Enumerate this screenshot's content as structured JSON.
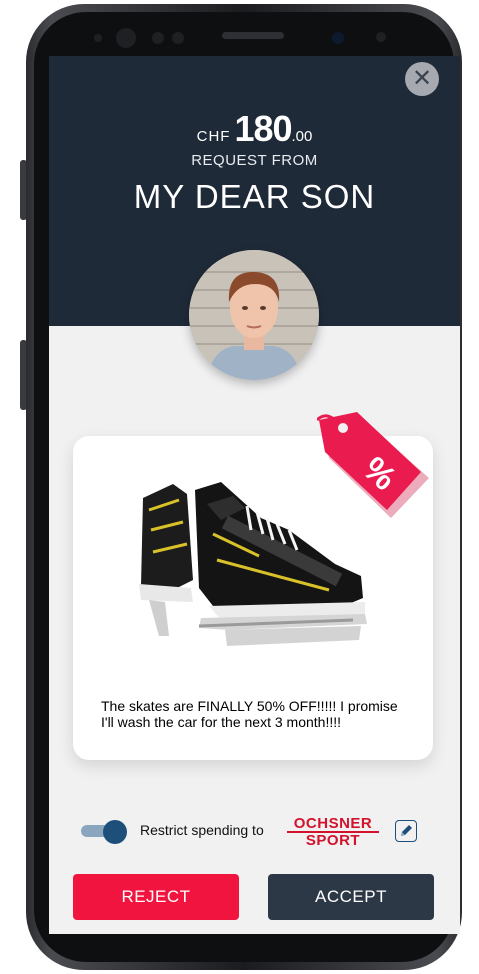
{
  "colors": {
    "header_bg": "#1f2a38",
    "reject_bg": "#f0143f",
    "accept_bg": "#2d3846",
    "tag_color": "#ea1b4f",
    "toggle_on": "#1d4f7a",
    "brand_red": "#d3122b"
  },
  "header": {
    "close_icon": "close-icon",
    "currency": "CHF",
    "amount": "180",
    "decimals": ".00",
    "request_label": "REQUEST FROM",
    "requester_name": "MY DEAR SON"
  },
  "card": {
    "message": "The skates are FINALLY 50% OFF!!!!! I promise I'll wash the car for the next 3 month!!!!",
    "discount_symbol": "%"
  },
  "restriction": {
    "toggle_on": true,
    "label": "Restrict spending to",
    "brand_line1": "OCHSNER",
    "brand_line2": "SPORT",
    "edit_icon": "edit-icon"
  },
  "actions": {
    "reject_label": "REJECT",
    "accept_label": "ACCEPT"
  }
}
